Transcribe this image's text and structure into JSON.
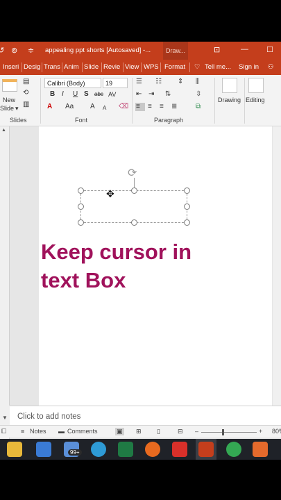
{
  "window": {
    "title": "appealing ppt shorts [Autosaved]  -...",
    "contextual_tab": "Draw..."
  },
  "tabs": [
    "Insert",
    "Design",
    "Trans",
    "Anim",
    "Slide",
    "Revie",
    "View",
    "WPS",
    "Format"
  ],
  "tab_display": [
    "Inseri",
    "Desig",
    "Trans",
    "Anim",
    "Slide",
    "Revie",
    "View",
    "WPS",
    "Format"
  ],
  "tell_me": "Tell me...",
  "sign_in": "Sign in",
  "ribbon": {
    "slides": {
      "new_slide_line1": "New",
      "new_slide_line2": "Slide",
      "group": "Slides"
    },
    "font": {
      "name": "Calibri (Body)",
      "size": "19",
      "group": "Font"
    },
    "paragraph": {
      "group": "Paragraph"
    },
    "drawing": {
      "label": "Drawing"
    },
    "editing": {
      "label": "Editing"
    }
  },
  "slide": {
    "text_line1": "Keep cursor in",
    "text_line2": "text Box",
    "text_color": "#a0125b"
  },
  "notes": {
    "placeholder": "Click to add notes"
  },
  "status": {
    "notes_label": "Notes",
    "comments_label": "Comments",
    "zoom": "80%",
    "zoom_fraction": 0.5
  },
  "taskbar": {
    "mail_badge": "99+"
  },
  "colors": {
    "brand": "#c43e1c",
    "slide_text": "#a0125b"
  }
}
